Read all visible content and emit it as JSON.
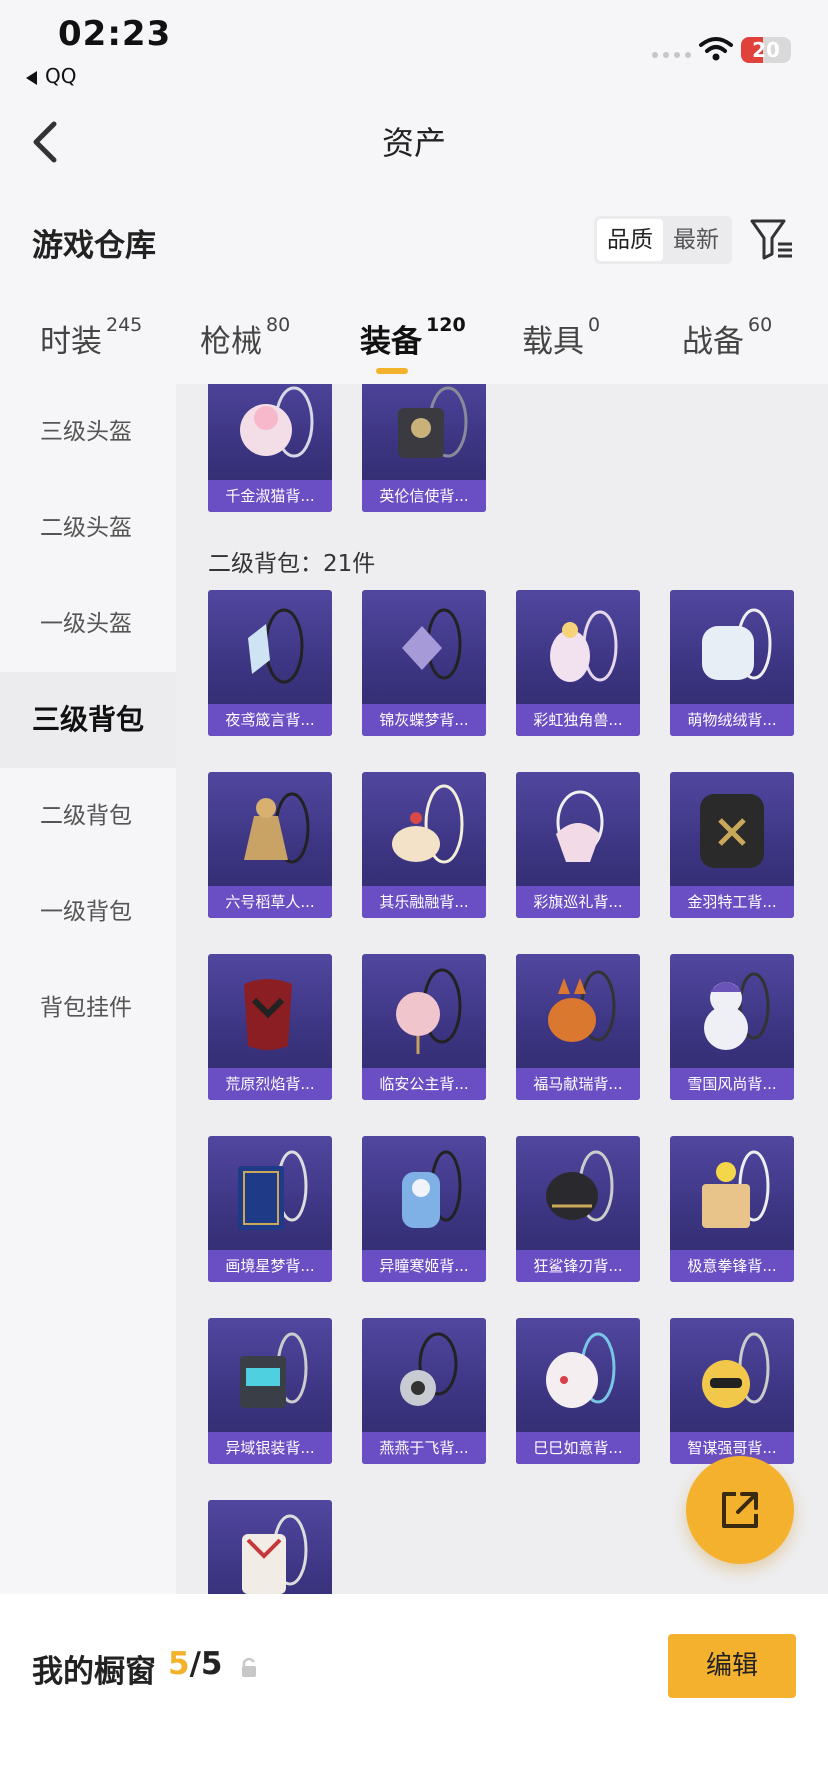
{
  "status_bar": {
    "time": "02:23",
    "back_app": "QQ",
    "battery": "20"
  },
  "nav": {
    "title": "资产"
  },
  "header": {
    "title": "游戏仓库",
    "sort_options": [
      "品质",
      "最新"
    ],
    "active_sort": "品质"
  },
  "tabs": [
    {
      "label": "时装",
      "count": "245"
    },
    {
      "label": "枪械",
      "count": "80"
    },
    {
      "label": "装备",
      "count": "120",
      "active": true
    },
    {
      "label": "载具",
      "count": "0"
    },
    {
      "label": "战备",
      "count": "60"
    }
  ],
  "sidebar": {
    "items": [
      "三级头盔",
      "二级头盔",
      "一级头盔",
      "三级背包",
      "二级背包",
      "一级背包",
      "背包挂件"
    ],
    "active": "三级背包"
  },
  "grid": {
    "top_items": [
      "千金淑猫背...",
      "英伦信使背..."
    ],
    "group_heading": "二级背包：21件",
    "items": [
      "夜鸢箴言背...",
      "锦灰蝶梦背...",
      "彩虹独角兽...",
      "萌物绒绒背...",
      "六号稻草人...",
      "其乐融融背...",
      "彩旗巡礼背...",
      "金羽特工背...",
      "荒原烈焰背...",
      "临安公主背...",
      "福马献瑞背...",
      "雪国风尚背...",
      "画境星梦背...",
      "异瞳寒姬背...",
      "狂鲨锋刃背...",
      "极意拳锋背...",
      "异域银装背...",
      "燕燕于飞背...",
      "巳巳如意背...",
      "智谋强哥背..."
    ]
  },
  "bottom_bar": {
    "title": "我的橱窗",
    "current": "5",
    "separator": "/",
    "total": "5",
    "edit_label": "编辑"
  },
  "colors": {
    "accent": "#f4b12e",
    "card_bg": "#3b3480",
    "card_label": "#6a4fc4"
  }
}
